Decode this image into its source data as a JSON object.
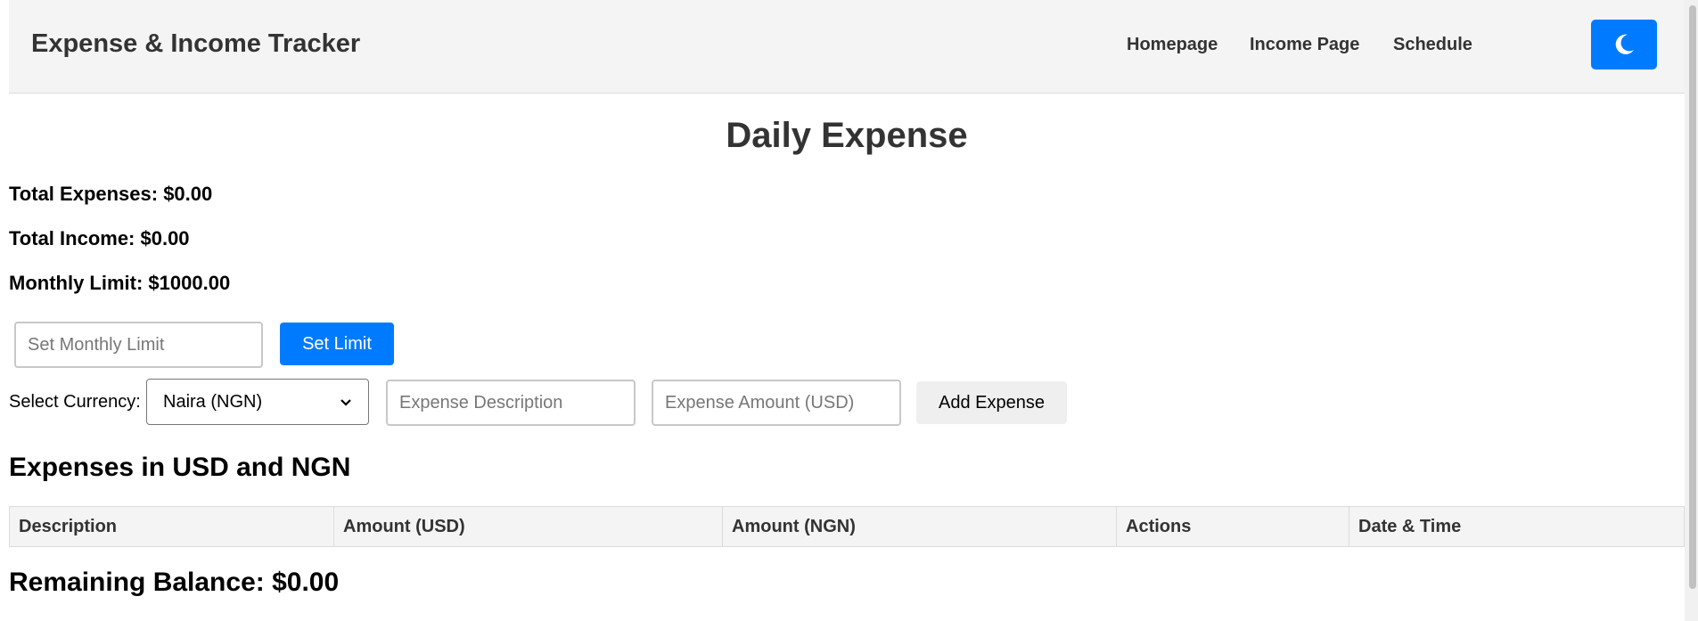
{
  "header": {
    "title": "Expense & Income Tracker",
    "nav": [
      {
        "label": "Homepage"
      },
      {
        "label": "Income Page"
      },
      {
        "label": "Schedule"
      }
    ],
    "theme_toggle_icon": "moon-icon"
  },
  "main": {
    "title": "Daily Expense",
    "total_expenses": "Total Expenses: $0.00",
    "total_income": "Total Income: $0.00",
    "monthly_limit": "Monthly Limit: $1000.00",
    "limit_input_placeholder": "Set Monthly Limit",
    "set_limit_label": "Set Limit",
    "currency_label": "Select Currency:",
    "currency_selected": "Naira (NGN)",
    "description_placeholder": "Expense Description",
    "amount_placeholder": "Expense Amount (USD)",
    "add_expense_label": "Add Expense",
    "table_title": "Expenses in USD and NGN",
    "table_columns": [
      "Description",
      "Amount (USD)",
      "Amount (NGN)",
      "Actions",
      "Date & Time"
    ],
    "remaining_balance": "Remaining Balance: $0.00"
  },
  "colors": {
    "accent": "#007bff",
    "header_bg": "#f4f4f4"
  }
}
